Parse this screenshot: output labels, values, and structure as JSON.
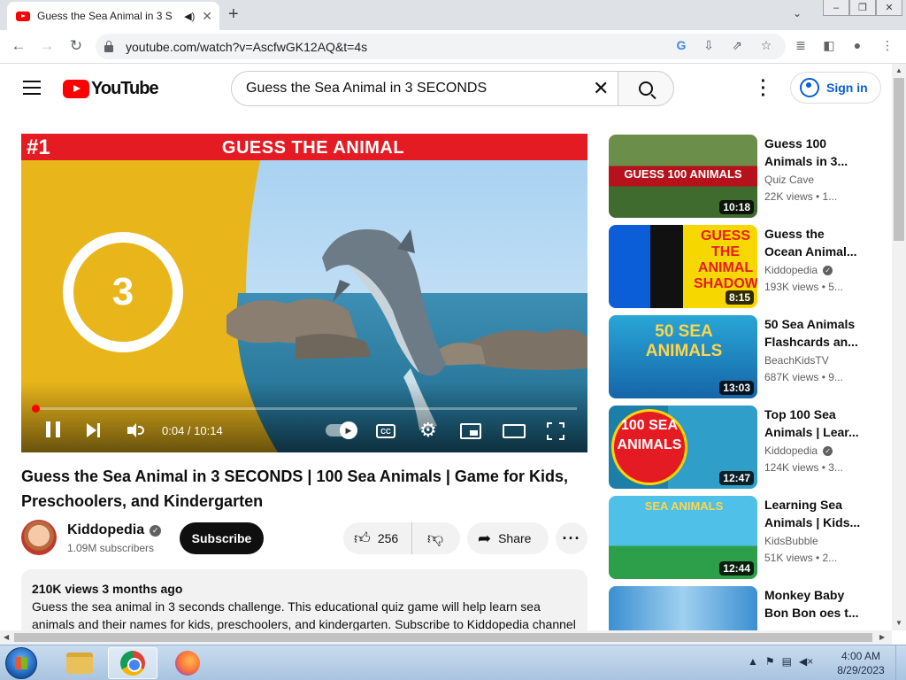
{
  "browser": {
    "tab_title": "Guess the Sea Animal in 3 S",
    "url": "youtube.com/watch?v=AscfwGK12AQ&t=4s",
    "win_controls": [
      "–",
      "❐",
      "✕"
    ]
  },
  "header": {
    "logo_text": "YouTube",
    "search_value": "Guess the Sea Animal in 3 SECONDS",
    "signin_label": "Sign in"
  },
  "player": {
    "banner_number": "#1",
    "banner_title": "GUESS THE ANIMAL",
    "countdown": "3",
    "time_display": "0:04 / 10:14",
    "progress": 0.0065,
    "cc_label": "CC"
  },
  "video": {
    "title": "Guess the Sea Animal in 3 SECONDS | 100 Sea Animals | Game for Kids, Preschoolers, and Kindergarten",
    "channel": "Kiddopedia",
    "subscribers": "1.09M subscribers",
    "subscribe_label": "Subscribe",
    "likes": "256",
    "share_label": "Share",
    "views_date": "210K views  3 months ago",
    "description": "Guess the sea animal in 3 seconds challenge. This educational quiz game will help learn sea animals and their names for kids, preschoolers, and kindergarten. Subscribe to Kiddopedia channel"
  },
  "recommendations": [
    {
      "title": "Guess 100 Animals in 3...",
      "channel": "Quiz Cave",
      "verified": false,
      "meta": "22K views  • 1...",
      "duration": "10:18",
      "thumb_text": "GUESS 100 ANIMALS"
    },
    {
      "title": "Guess the Ocean Animal...",
      "channel": "Kiddopedia",
      "verified": true,
      "meta": "193K views  • 5...",
      "duration": "8:15",
      "thumb_text": "GUESS THE ANIMAL SHADOW"
    },
    {
      "title": "50 Sea Animals Flashcards an...",
      "channel": "BeachKidsTV",
      "verified": false,
      "meta": "687K views  • 9...",
      "duration": "13:03",
      "thumb_text": "50 SEA ANIMALS"
    },
    {
      "title": "Top 100 Sea Animals | Lear...",
      "channel": "Kiddopedia",
      "verified": true,
      "meta": "124K views  • 3...",
      "duration": "12:47",
      "thumb_text": "100 SEA ANIMALS"
    },
    {
      "title": "Learning Sea Animals | Kids...",
      "channel": "KidsBubble",
      "verified": false,
      "meta": "51K views  • 2...",
      "duration": "12:44",
      "thumb_text": "SEA ANIMALS"
    },
    {
      "title": "Monkey Baby Bon Bon oes t...",
      "channel": "",
      "verified": false,
      "meta": "",
      "duration": "",
      "thumb_text": ""
    }
  ],
  "taskbar": {
    "clock_time": "4:00 AM",
    "clock_date": "8/29/2023"
  },
  "colors": {
    "yt_red": "#ff0000",
    "link_blue": "#065fd4",
    "banner_red": "#e51b23",
    "ring_yellow": "#e8b51b"
  }
}
